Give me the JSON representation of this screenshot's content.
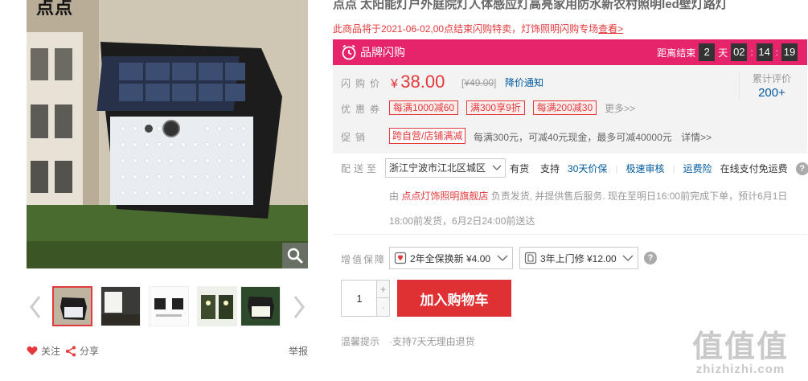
{
  "brand": {
    "logo": "点点"
  },
  "product": {
    "title": "点点 太阳能灯户外庭院灯人体感应灯高亮家用防水新农村照明led壁灯路灯",
    "notice": "此商品将于2021-06-02,00点结束闪购特卖，灯饰照明闪购专场",
    "notice_link": "查看>"
  },
  "flash_sale": {
    "label": "品牌闪购",
    "countdown_prefix": "距离结束",
    "days": "2",
    "days_unit": "天",
    "hours": "02",
    "minutes": "14",
    "seconds": "19",
    "colon": ":"
  },
  "price": {
    "label": "闪购价",
    "currency": "¥",
    "value": "38.00",
    "original": "¥49.00",
    "drop_notice": "降价通知"
  },
  "reviews": {
    "label": "累计评价",
    "count": "200+"
  },
  "coupons": {
    "label": "优惠券",
    "items": [
      "每满1000减60",
      "满300享9折",
      "每满200减30"
    ],
    "more": "更多>>"
  },
  "promotion": {
    "label": "促销",
    "tag": "跨自营/店铺满减",
    "text": "每满300元，可减40元现金，最多可减40000元",
    "detail": "详情>>"
  },
  "shipping": {
    "label": "配送至",
    "region": "浙江宁波市江北区城区",
    "stock": "有货",
    "support": "支持",
    "services": [
      "30天价保",
      "极速审核",
      "运费险"
    ],
    "payment": "在线支付免运费",
    "help": "?",
    "from": "由",
    "shop": "点点灯饰照明旗舰店",
    "desc": "负责发货, 并提供售后服务. 现在至明日16:00前完成下单，预计6月1日18:00前发货，6月2日24:00前送达"
  },
  "value_added": {
    "label": "增值保障",
    "option1": "2年全保换新 ¥4.00",
    "option2": "3年上门修 ¥12.00",
    "help": "?"
  },
  "purchase": {
    "quantity": "1",
    "plus": "+",
    "minus": "-",
    "add_to_cart": "加入购物车"
  },
  "tips": {
    "label": "温馨提示",
    "text": "·支持7天无理由退货"
  },
  "social": {
    "favorite": "关注",
    "share": "分享",
    "report": "举报"
  },
  "gallery": {
    "thumb_count": 5,
    "active_index": 0
  },
  "watermark": {
    "glyphs": "值值值",
    "url": "zhizhizhi.com"
  },
  "colors": {
    "accent": "#e4393c",
    "flash": "#e5246b",
    "link": "#005aa0",
    "cart": "#df3033"
  }
}
